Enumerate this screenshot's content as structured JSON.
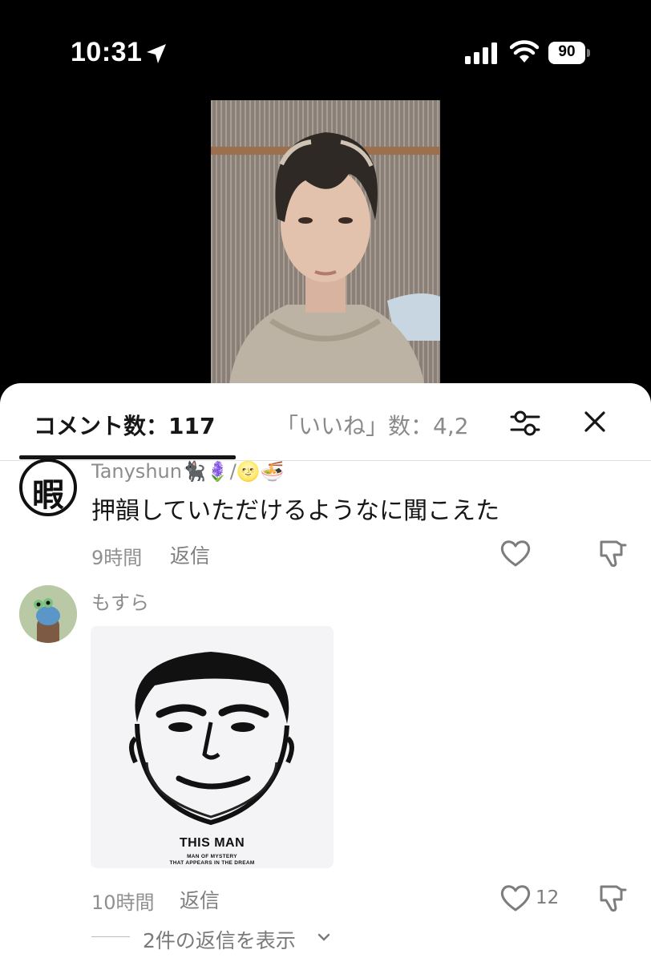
{
  "status_bar": {
    "time": "10:31",
    "battery": "90",
    "icons": [
      "location-arrow-icon",
      "signal-bars-icon",
      "wifi-icon",
      "battery-icon"
    ]
  },
  "comment_sheet": {
    "tabs": {
      "comments_tab": "コメント数：117",
      "likes_tab": "「いいね」数：4,2"
    },
    "icons": [
      "sliders-filter-icon",
      "close-icon"
    ]
  },
  "comments": [
    {
      "username": "Tanyshun🐈‍⬛🪻/🌝🍜",
      "avatar_icon": "kanji-hima-avatar",
      "avatar_text": "暇",
      "text": "押韻していただけるようなに聞こえた",
      "time": "9時間",
      "reply_label": "返信"
    },
    {
      "username": "もすら",
      "avatar_icon": "cartoon-avatar",
      "image": {
        "title": "THIS MAN",
        "subtitle_line1": "MAN OF MYSTERY",
        "subtitle_line2": "THAT APPEARS IN THE DREAM"
      },
      "time": "10時間",
      "reply_label": "返信",
      "like_count": "12",
      "view_replies": "2件の返信を表示"
    }
  ],
  "colors": {
    "sheet_background": "#ffffff",
    "primary_text": "#161616",
    "secondary_text": "#8a8a8a",
    "top_background": "#000000"
  }
}
